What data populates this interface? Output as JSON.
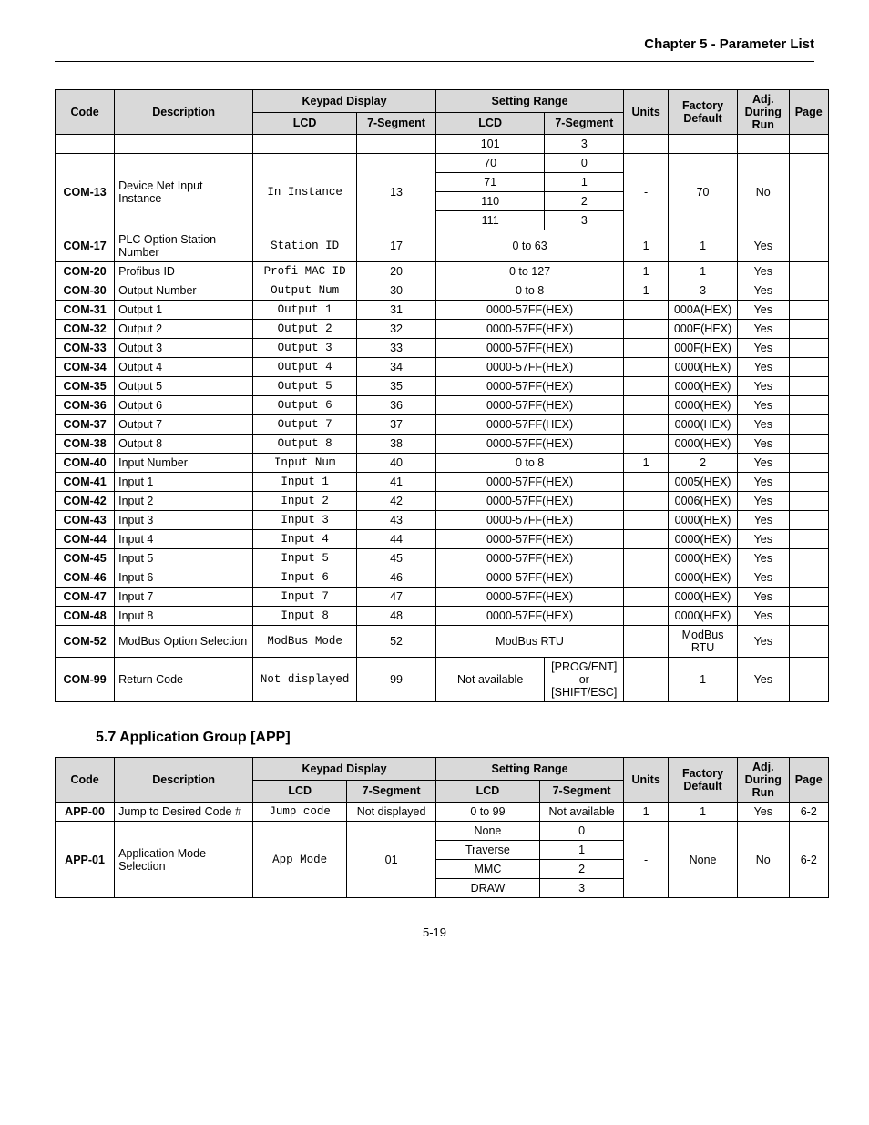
{
  "header": {
    "chapter": "Chapter 5 - Parameter List"
  },
  "pageNumber": "5-19",
  "tableHeaders": {
    "code": "Code",
    "description": "Description",
    "keypadDisplay": "Keypad Display",
    "lcd": "LCD",
    "seg7": "7-Segment",
    "settingRange": "Setting Range",
    "units": "Units",
    "factoryDefault": "Factory Default",
    "adjDuringRun": "Adj. During Run",
    "page": "Page"
  },
  "table1": {
    "prevRow": {
      "lcdRange": "101",
      "segRange": "3"
    },
    "rows": [
      {
        "code": "COM-13",
        "desc": "Device Net Input Instance",
        "lcd": "In Instance",
        "seg": "13",
        "rangeLcd": [
          "70",
          "71",
          "110",
          "111"
        ],
        "rangeSeg": [
          "0",
          "1",
          "2",
          "3"
        ],
        "units": "-",
        "default": "70",
        "adj": "No",
        "page": ""
      },
      {
        "code": "COM-17",
        "desc": "PLC Option Station Number",
        "lcd": "Station ID",
        "seg": "17",
        "rangeMerged": "0 to 63",
        "units": "1",
        "default": "1",
        "adj": "Yes",
        "page": ""
      },
      {
        "code": "COM-20",
        "desc": "Profibus ID",
        "lcd": "Profi MAC ID",
        "seg": "20",
        "rangeMerged": "0 to 127",
        "units": "1",
        "default": "1",
        "adj": "Yes",
        "page": ""
      },
      {
        "code": "COM-30",
        "desc": "Output Number",
        "lcd": "Output Num",
        "seg": "30",
        "rangeMerged": "0 to 8",
        "units": "1",
        "default": "3",
        "adj": "Yes",
        "page": ""
      },
      {
        "code": "COM-31",
        "desc": "Output 1",
        "lcd": "Output 1",
        "seg": "31",
        "rangeMerged": "0000-57FF(HEX)",
        "units": "",
        "default": "000A(HEX)",
        "adj": "Yes",
        "page": ""
      },
      {
        "code": "COM-32",
        "desc": "Output 2",
        "lcd": "Output 2",
        "seg": "32",
        "rangeMerged": "0000-57FF(HEX)",
        "units": "",
        "default": "000E(HEX)",
        "adj": "Yes",
        "page": ""
      },
      {
        "code": "COM-33",
        "desc": "Output 3",
        "lcd": "Output 3",
        "seg": "33",
        "rangeMerged": "0000-57FF(HEX)",
        "units": "",
        "default": "000F(HEX)",
        "adj": "Yes",
        "page": ""
      },
      {
        "code": "COM-34",
        "desc": "Output 4",
        "lcd": "Output 4",
        "seg": "34",
        "rangeMerged": "0000-57FF(HEX)",
        "units": "",
        "default": "0000(HEX)",
        "adj": "Yes",
        "page": ""
      },
      {
        "code": "COM-35",
        "desc": "Output 5",
        "lcd": "Output 5",
        "seg": "35",
        "rangeMerged": "0000-57FF(HEX)",
        "units": "",
        "default": "0000(HEX)",
        "adj": "Yes",
        "page": ""
      },
      {
        "code": "COM-36",
        "desc": "Output 6",
        "lcd": "Output 6",
        "seg": "36",
        "rangeMerged": "0000-57FF(HEX)",
        "units": "",
        "default": "0000(HEX)",
        "adj": "Yes",
        "page": ""
      },
      {
        "code": "COM-37",
        "desc": "Output 7",
        "lcd": "Output 7",
        "seg": "37",
        "rangeMerged": "0000-57FF(HEX)",
        "units": "",
        "default": "0000(HEX)",
        "adj": "Yes",
        "page": ""
      },
      {
        "code": "COM-38",
        "desc": "Output 8",
        "lcd": "Output 8",
        "seg": "38",
        "rangeMerged": "0000-57FF(HEX)",
        "units": "",
        "default": "0000(HEX)",
        "adj": "Yes",
        "page": ""
      },
      {
        "code": "COM-40",
        "desc": "Input Number",
        "lcd": "Input Num",
        "seg": "40",
        "rangeMerged": "0 to 8",
        "units": "1",
        "default": "2",
        "adj": "Yes",
        "page": ""
      },
      {
        "code": "COM-41",
        "desc": "Input 1",
        "lcd": "Input 1",
        "seg": "41",
        "rangeMerged": "0000-57FF(HEX)",
        "units": "",
        "default": "0005(HEX)",
        "adj": "Yes",
        "page": ""
      },
      {
        "code": "COM-42",
        "desc": "Input 2",
        "lcd": "Input 2",
        "seg": "42",
        "rangeMerged": "0000-57FF(HEX)",
        "units": "",
        "default": "0006(HEX)",
        "adj": "Yes",
        "page": ""
      },
      {
        "code": "COM-43",
        "desc": "Input 3",
        "lcd": "Input 3",
        "seg": "43",
        "rangeMerged": "0000-57FF(HEX)",
        "units": "",
        "default": "0000(HEX)",
        "adj": "Yes",
        "page": ""
      },
      {
        "code": "COM-44",
        "desc": "Input 4",
        "lcd": "Input 4",
        "seg": "44",
        "rangeMerged": "0000-57FF(HEX)",
        "units": "",
        "default": "0000(HEX)",
        "adj": "Yes",
        "page": ""
      },
      {
        "code": "COM-45",
        "desc": "Input 5",
        "lcd": "Input 5",
        "seg": "45",
        "rangeMerged": "0000-57FF(HEX)",
        "units": "",
        "default": "0000(HEX)",
        "adj": "Yes",
        "page": ""
      },
      {
        "code": "COM-46",
        "desc": "Input 6",
        "lcd": "Input 6",
        "seg": "46",
        "rangeMerged": "0000-57FF(HEX)",
        "units": "",
        "default": "0000(HEX)",
        "adj": "Yes",
        "page": ""
      },
      {
        "code": "COM-47",
        "desc": "Input 7",
        "lcd": "Input 7",
        "seg": "47",
        "rangeMerged": "0000-57FF(HEX)",
        "units": "",
        "default": "0000(HEX)",
        "adj": "Yes",
        "page": ""
      },
      {
        "code": "COM-48",
        "desc": "Input 8",
        "lcd": "Input 8",
        "seg": "48",
        "rangeMerged": "0000-57FF(HEX)",
        "units": "",
        "default": "0000(HEX)",
        "adj": "Yes",
        "page": ""
      },
      {
        "code": "COM-52",
        "desc": "ModBus Option Selection",
        "lcd": "ModBus Mode",
        "seg": "52",
        "rangeMerged": "ModBus RTU",
        "units": "",
        "default": "ModBus RTU",
        "adj": "Yes",
        "page": ""
      },
      {
        "code": "COM-99",
        "desc": "Return Code",
        "lcd": "Not displayed",
        "seg": "99",
        "rangeLcdSingle": "Not available",
        "rangeSegSingle": "[PROG/ENT] or [SHIFT/ESC]",
        "units": "-",
        "default": "1",
        "adj": "Yes",
        "page": ""
      }
    ]
  },
  "section2": {
    "heading": "5.7  Application Group [APP]"
  },
  "table2": {
    "rows": [
      {
        "code": "APP-00",
        "desc": "Jump to Desired Code #",
        "lcd": "Jump code",
        "seg": "Not displayed",
        "rangeLcdSingle": "0 to 99",
        "rangeSegSingle": "Not available",
        "units": "1",
        "default": "1",
        "adj": "Yes",
        "page": "6-2"
      },
      {
        "code": "APP-01",
        "desc": "Application Mode Selection",
        "lcd": "App Mode",
        "seg": "01",
        "rangeLcd": [
          "None",
          "Traverse",
          "MMC",
          "DRAW"
        ],
        "rangeSeg": [
          "0",
          "1",
          "2",
          "3"
        ],
        "units": "-",
        "default": "None",
        "adj": "No",
        "page": "6-2"
      }
    ]
  }
}
